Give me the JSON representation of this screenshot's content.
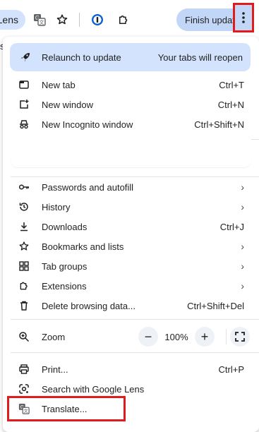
{
  "toolbar": {
    "lens_label": "Lens",
    "finish_update_label": "Finish update",
    "icons": [
      "google-translate-icon",
      "bookmark-star-icon",
      "password-manager-icon",
      "extensions-puzzle-icon",
      "kebab-menu-icon"
    ]
  },
  "page_fragment": {
    "left_char": "s"
  },
  "menu": {
    "relaunch": {
      "label": "Relaunch to update",
      "note": "Your tabs will reopen"
    },
    "group1": [
      {
        "icon": "new-tab-icon",
        "label": "New tab",
        "shortcut": "Ctrl+T"
      },
      {
        "icon": "new-window-icon",
        "label": "New window",
        "shortcut": "Ctrl+N"
      },
      {
        "icon": "incognito-icon",
        "label": "New Incognito window",
        "shortcut": "Ctrl+Shift+N"
      }
    ],
    "group2": [
      {
        "icon": "key-icon",
        "label": "Passwords and autofill",
        "chevron": "›"
      },
      {
        "icon": "history-icon",
        "label": "History",
        "chevron": "›"
      },
      {
        "icon": "download-icon",
        "label": "Downloads",
        "shortcut": "Ctrl+J"
      },
      {
        "icon": "star-icon",
        "label": "Bookmarks and lists",
        "chevron": "›"
      },
      {
        "icon": "tab-groups-icon",
        "label": "Tab groups",
        "chevron": "›"
      },
      {
        "icon": "extensions-icon",
        "label": "Extensions",
        "chevron": "›"
      },
      {
        "icon": "trash-icon",
        "label": "Delete browsing data...",
        "shortcut": "Ctrl+Shift+Del"
      }
    ],
    "zoom": {
      "label": "Zoom",
      "minus": "−",
      "value": "100%",
      "plus": "+"
    },
    "group3": [
      {
        "icon": "print-icon",
        "label": "Print...",
        "shortcut": "Ctrl+P"
      },
      {
        "icon": "google-lens-icon",
        "label": "Search with Google Lens"
      },
      {
        "icon": "translate-icon",
        "label": "Translate..."
      }
    ]
  },
  "colors": {
    "accent": "#d3e3fd",
    "finish_button": "#c2d7f7",
    "highlight_red": "#e01b1b",
    "text": "#1f1f1f"
  }
}
